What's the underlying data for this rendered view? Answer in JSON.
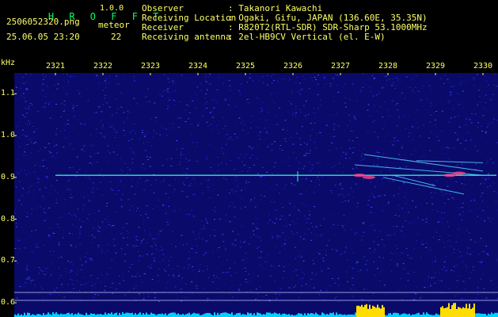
{
  "header": {
    "app_title": "H R O F F T",
    "version": "1.0.0",
    "filename": "2506052320.png",
    "meteor_label": "meteor",
    "datetime": "25.06.05 23:20",
    "meteor_count": "22",
    "fields": [
      {
        "label": "Observer",
        "value": ": Takanori Kawachi"
      },
      {
        "label": "Receiving Location",
        "value": ": Ogaki, Gifu, JAPAN (136.60E, 35.35N)"
      },
      {
        "label": "Receiver",
        "value": ": R820T2(RTL-SDR) SDR-Sharp 53.1000MHz"
      },
      {
        "label": "Receiving antenna",
        "value": ": 2el-HB9CV Vertical (el. E-W)"
      }
    ]
  },
  "chart_data": {
    "type": "heatmap",
    "ylabel": "kHz",
    "x_ticks": [
      "2321",
      "2322",
      "2323",
      "2324",
      "2325",
      "2326",
      "2327",
      "2328",
      "2329",
      "2330"
    ],
    "y_ticks": [
      "1.1",
      "1.0",
      "0.9",
      "0.8",
      "0.7",
      "0.6"
    ],
    "x_range": [
      2321,
      2330
    ],
    "y_range": [
      0.6,
      1.15
    ],
    "carrier_khz": 0.905,
    "carrier_start": 2321,
    "colors": {
      "background": "#0a0a6a",
      "noise": "#2a2aff",
      "trace": "#33ffcc",
      "hot": "#ff4488",
      "bar": "#00d0ff",
      "peak": "#ffdd00",
      "text": "#ffff66"
    }
  }
}
